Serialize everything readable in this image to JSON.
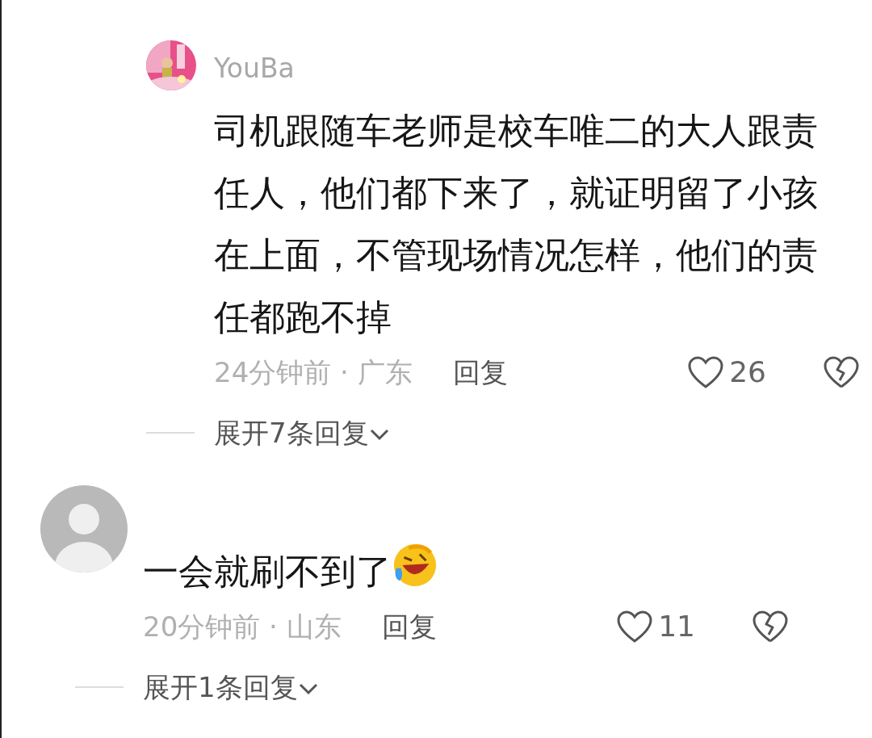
{
  "comments": [
    {
      "kind": "reply",
      "username": "YouBa",
      "text": "司机跟随车老师是校车唯二的大人跟责任人，他们都下来了，就证明留了小孩在上面，不管现场情况怎样，他们的责任都跑不掉",
      "time_location": "24分钟前 · 广东",
      "reply_label": "回复",
      "likes": "26",
      "liked": false,
      "expand_label": "展开7条回复"
    },
    {
      "kind": "top",
      "text": "一会就刷不到了",
      "emoji": true,
      "time_location": "20分钟前 · 山东",
      "reply_label": "回复",
      "likes": "11",
      "liked": false,
      "expand_label": "展开1条回复"
    }
  ]
}
